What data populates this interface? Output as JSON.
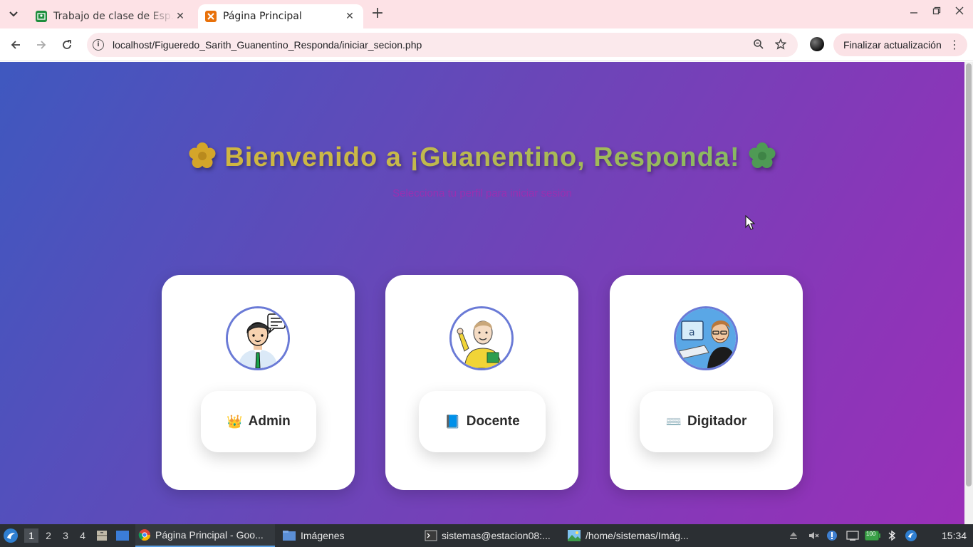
{
  "browser": {
    "tabs": [
      {
        "title": "Trabajo de clase de Esp. Sarith",
        "favicon_color": "#1e8e3e"
      },
      {
        "title": "Página Principal",
        "favicon_color": "#e8710a"
      }
    ],
    "url": "localhost/Figueredo_Sarith_Guanentino_Responda/iniciar_secion.php",
    "update_button": "Finalizar actualización"
  },
  "page": {
    "title": "Bienvenido a ¡Guanentino, Responda!",
    "subtitle": "Selecciona tu perfil para iniciar sesión",
    "roles": [
      {
        "label": "Admin",
        "emoji": "👑"
      },
      {
        "label": "Docente",
        "emoji": "📘"
      },
      {
        "label": "Digitador",
        "emoji": "⌨️"
      }
    ]
  },
  "taskbar": {
    "workspaces": [
      "1",
      "2",
      "3",
      "4"
    ],
    "tasks": [
      {
        "title": "Página Principal - Goo..."
      },
      {
        "title": "Imágenes"
      },
      {
        "title": "sistemas@estacion08:..."
      },
      {
        "title": "/home/sistemas/Imág..."
      }
    ],
    "battery": "100",
    "clock": "15:34"
  }
}
